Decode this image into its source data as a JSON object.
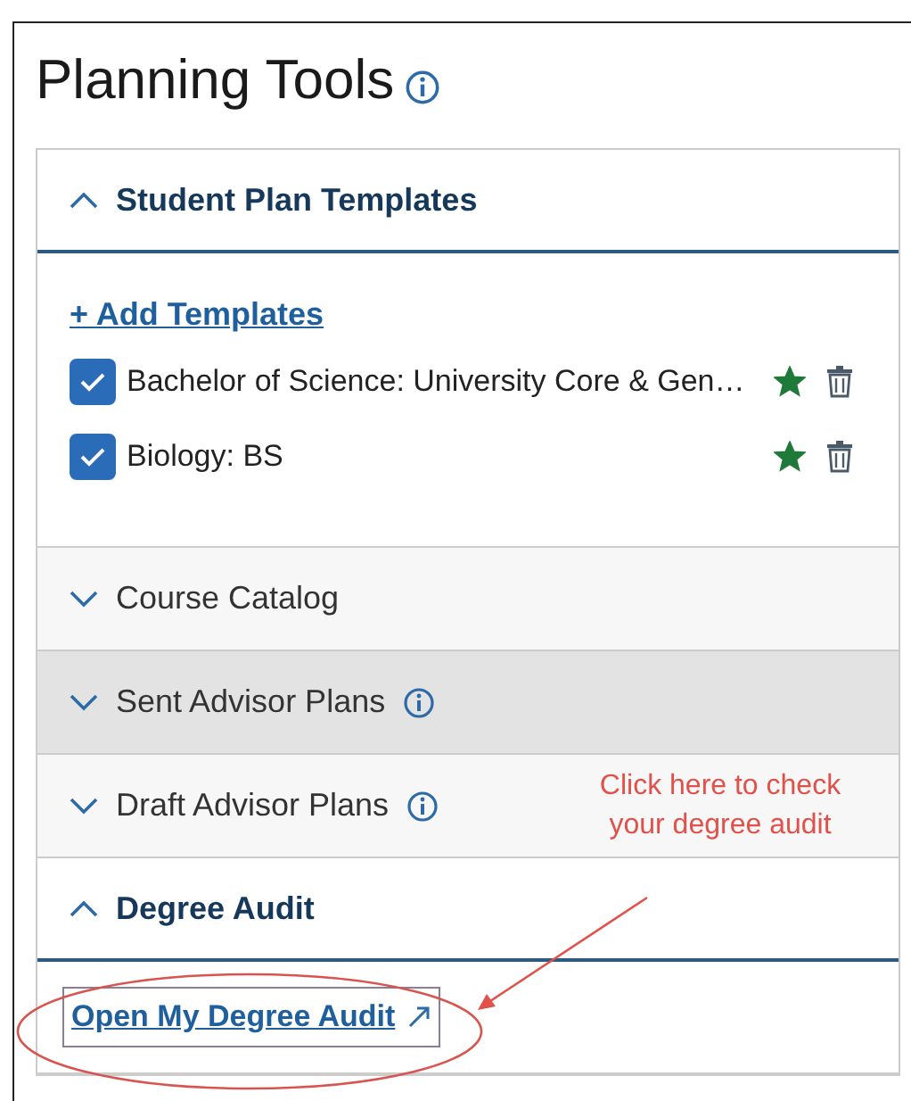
{
  "title": "Planning Tools",
  "sections": [
    {
      "title": "Student Plan Templates",
      "expanded": true,
      "kind": "templates",
      "add_link": "+ Add Templates",
      "templates": [
        {
          "name": "Bachelor of Science: University Core & Gen…",
          "checked": true,
          "starred": true
        },
        {
          "name": "Biology: BS",
          "checked": true,
          "starred": true
        }
      ]
    },
    {
      "title": "Course Catalog",
      "expanded": false
    },
    {
      "title": "Sent Advisor Plans",
      "expanded": false,
      "info": true,
      "hovered": true
    },
    {
      "title": "Draft Advisor Plans",
      "expanded": false,
      "info": true,
      "note": "Click here to check your degree audit"
    },
    {
      "title": "Degree Audit",
      "expanded": true,
      "kind": "audit",
      "link": "Open My Degree Audit"
    }
  ]
}
